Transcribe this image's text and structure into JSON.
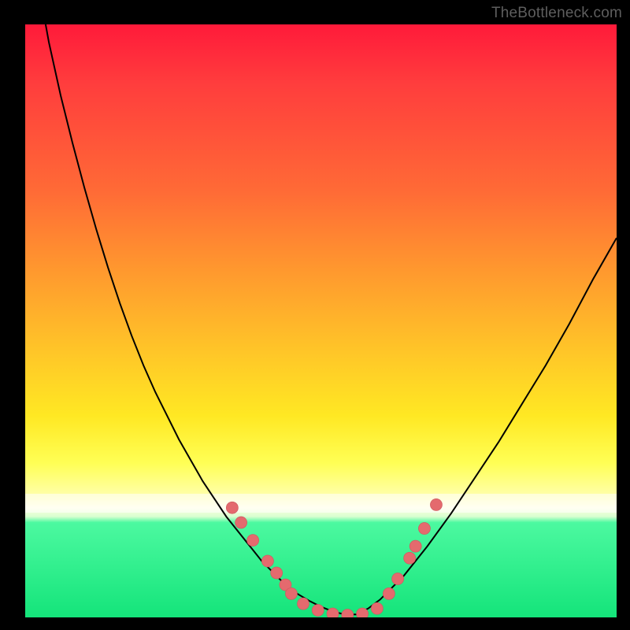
{
  "attribution": "TheBottleneck.com",
  "colors": {
    "frame": "#000000",
    "curve": "#000000",
    "markerFill": "#e46a6e",
    "markerStroke": "#cf5c61"
  },
  "chart_data": {
    "type": "line",
    "title": "",
    "xlabel": "",
    "ylabel": "",
    "xlim": [
      0,
      100
    ],
    "ylim": [
      0,
      100
    ],
    "x": [
      0,
      2,
      4,
      6,
      8,
      10,
      12,
      14,
      16,
      18,
      20,
      22,
      24,
      26,
      28,
      30,
      32,
      34,
      36,
      38,
      40,
      42,
      44,
      46,
      48,
      50,
      52,
      54,
      56,
      58,
      60,
      64,
      68,
      72,
      76,
      80,
      84,
      88,
      92,
      96,
      100
    ],
    "values": [
      120,
      108,
      97,
      88,
      80,
      72.5,
      65.5,
      59,
      53,
      47.5,
      42.5,
      38,
      34,
      30,
      26.5,
      23,
      20,
      17,
      14.5,
      12,
      9.5,
      7.5,
      5.5,
      4,
      2.8,
      1.8,
      1,
      0.5,
      0.5,
      1.5,
      3,
      7,
      12,
      17.5,
      23.5,
      29.5,
      36,
      42.5,
      49.5,
      57,
      64
    ],
    "grid": false,
    "legend": false,
    "markers": {
      "left_cluster": [
        {
          "x": 35,
          "y": 18.5
        },
        {
          "x": 36.5,
          "y": 16
        },
        {
          "x": 38.5,
          "y": 13
        },
        {
          "x": 41,
          "y": 9.5
        },
        {
          "x": 42.5,
          "y": 7.5
        },
        {
          "x": 44,
          "y": 5.5
        },
        {
          "x": 45,
          "y": 4
        }
      ],
      "bottom_cluster": [
        {
          "x": 47,
          "y": 2.3
        },
        {
          "x": 49.5,
          "y": 1.2
        },
        {
          "x": 52,
          "y": 0.6
        },
        {
          "x": 54.5,
          "y": 0.4
        },
        {
          "x": 57,
          "y": 0.6
        },
        {
          "x": 59.5,
          "y": 1.5
        }
      ],
      "right_cluster": [
        {
          "x": 61.5,
          "y": 4
        },
        {
          "x": 63,
          "y": 6.5
        },
        {
          "x": 65,
          "y": 10
        },
        {
          "x": 66,
          "y": 12
        },
        {
          "x": 67.5,
          "y": 15
        },
        {
          "x": 69.5,
          "y": 19
        }
      ]
    }
  }
}
